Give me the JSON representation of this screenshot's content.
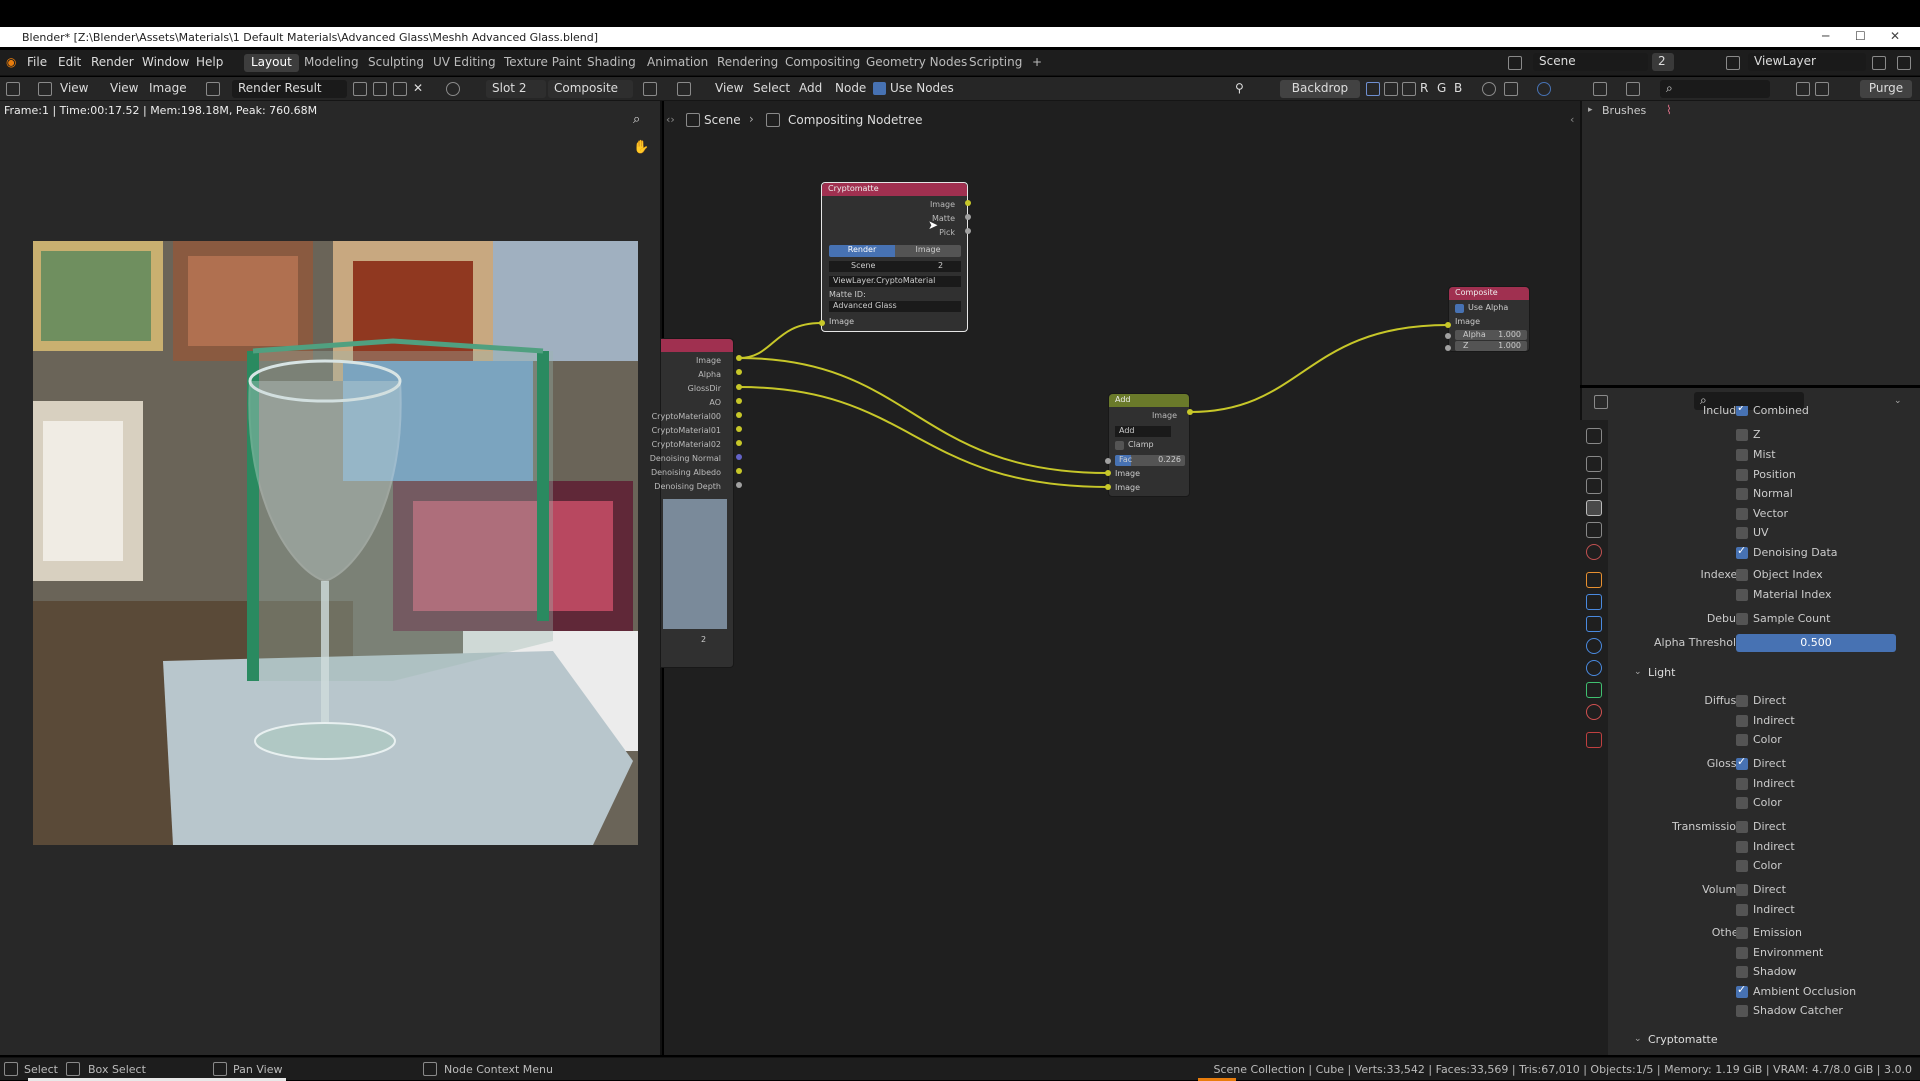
{
  "title": "Blender* [Z:\\Blender\\Assets\\Materials\\1 Default Materials\\Advanced Glass\\Meshh Advanced Glass.blend]",
  "menu": [
    "File",
    "Edit",
    "Render",
    "Window",
    "Help"
  ],
  "workspaces": [
    "Layout",
    "Modeling",
    "Sculpting",
    "UV Editing",
    "Texture Paint",
    "Shading",
    "Animation",
    "Rendering",
    "Compositing",
    "Geometry Nodes",
    "Scripting",
    "+"
  ],
  "active_workspace": "Layout",
  "scene_field": "Scene",
  "scene_users": "2",
  "viewlayer_field": "ViewLayer",
  "image_editor": {
    "view": "View",
    "view2": "View",
    "image": "Image",
    "image_name": "Render Result",
    "slot": "Slot 2",
    "pass": "Composite",
    "info": "Frame:1 | Time:00:17.52 | Mem:198.18M, Peak: 760.68M"
  },
  "node_editor": {
    "menus": [
      "View",
      "Select",
      "Add",
      "Node"
    ],
    "use_nodes": "Use Nodes",
    "backdrop": "Backdrop",
    "channels": [
      "R",
      "G",
      "B"
    ],
    "breadcrumb_scene": "Scene",
    "breadcrumb_tree": "Compositing Nodetree",
    "rl_outputs": [
      "Image",
      "Alpha",
      "GlossDir",
      "AO",
      "CryptoMaterial00",
      "CryptoMaterial01",
      "CryptoMaterial02",
      "Denoising Normal",
      "Denoising Albedo",
      "Denoising Depth"
    ],
    "rl_num": "2",
    "crypto": {
      "title": "Cryptomatte",
      "outputs": [
        "Image",
        "Matte",
        "Pick"
      ],
      "tab_render": "Render",
      "tab_image": "Image",
      "scene": "Scene",
      "scene_num": "2",
      "layer": "ViewLayer.CryptoMaterial",
      "matte_label": "Matte ID:",
      "matte_value": "Advanced Glass",
      "input": "Image"
    },
    "add": {
      "title": "Add",
      "output": "Image",
      "mode": "Add",
      "clamp": "Clamp",
      "fac_label": "Fac",
      "fac_value": "0.226",
      "inputs": [
        "Image",
        "Image"
      ]
    },
    "composite": {
      "title": "Composite",
      "use_alpha": "Use Alpha",
      "input": "Image",
      "alpha_label": "Alpha",
      "alpha_value": "1.000",
      "z_label": "Z",
      "z_value": "1.000"
    }
  },
  "outliner": {
    "item": "Brushes",
    "purge": "Purge"
  },
  "props": {
    "include_label": "Include",
    "include_items": [
      {
        "label": "Combined",
        "checked": true
      },
      {
        "label": "Z",
        "checked": false
      },
      {
        "label": "Mist",
        "checked": false
      },
      {
        "label": "Position",
        "checked": false
      },
      {
        "label": "Normal",
        "checked": false
      },
      {
        "label": "Vector",
        "checked": false
      },
      {
        "label": "UV",
        "checked": false
      },
      {
        "label": "Denoising Data",
        "checked": true
      }
    ],
    "indexes_label": "Indexes",
    "indexes": [
      {
        "label": "Object Index",
        "checked": false
      },
      {
        "label": "Material Index",
        "checked": false
      }
    ],
    "debug_label": "Debug",
    "debug_item": "Sample Count",
    "alpha_label": "Alpha Threshold",
    "alpha_value": "0.500",
    "light_section": "Light",
    "diffuse_label": "Diffuse",
    "diffuse": [
      {
        "label": "Direct",
        "checked": false
      },
      {
        "label": "Indirect",
        "checked": false
      },
      {
        "label": "Color",
        "checked": false
      }
    ],
    "glossy_label": "Glossy",
    "glossy": [
      {
        "label": "Direct",
        "checked": true
      },
      {
        "label": "Indirect",
        "checked": false
      },
      {
        "label": "Color",
        "checked": false
      }
    ],
    "transmission_label": "Transmission",
    "transmission": [
      {
        "label": "Direct",
        "checked": false
      },
      {
        "label": "Indirect",
        "checked": false
      },
      {
        "label": "Color",
        "checked": false
      }
    ],
    "volume_label": "Volume",
    "volume": [
      {
        "label": "Direct",
        "checked": false
      },
      {
        "label": "Indirect",
        "checked": false
      }
    ],
    "other_label": "Other",
    "other": [
      {
        "label": "Emission",
        "checked": false
      },
      {
        "label": "Environment",
        "checked": false
      },
      {
        "label": "Shadow",
        "checked": false
      },
      {
        "label": "Ambient Occlusion",
        "checked": true
      },
      {
        "label": "Shadow Catcher",
        "checked": false
      }
    ],
    "crypto_section": "Cryptomatte"
  },
  "status": {
    "select": "Select",
    "box_select": "Box Select",
    "pan": "Pan View",
    "context": "Node Context Menu",
    "info": "Scene Collection | Cube | Verts:33,542 | Faces:33,569 | Tris:67,010 | Objects:1/5 | Memory: 1.19 GiB | VRAM: 4.7/8.0 GiB | 3.0.0"
  },
  "colors": {
    "accent": "#4772b3",
    "node_wire": "#c7c729",
    "crypto_header": "#a03050",
    "add_header": "#6a7a2a",
    "composite_header": "#a03050"
  }
}
